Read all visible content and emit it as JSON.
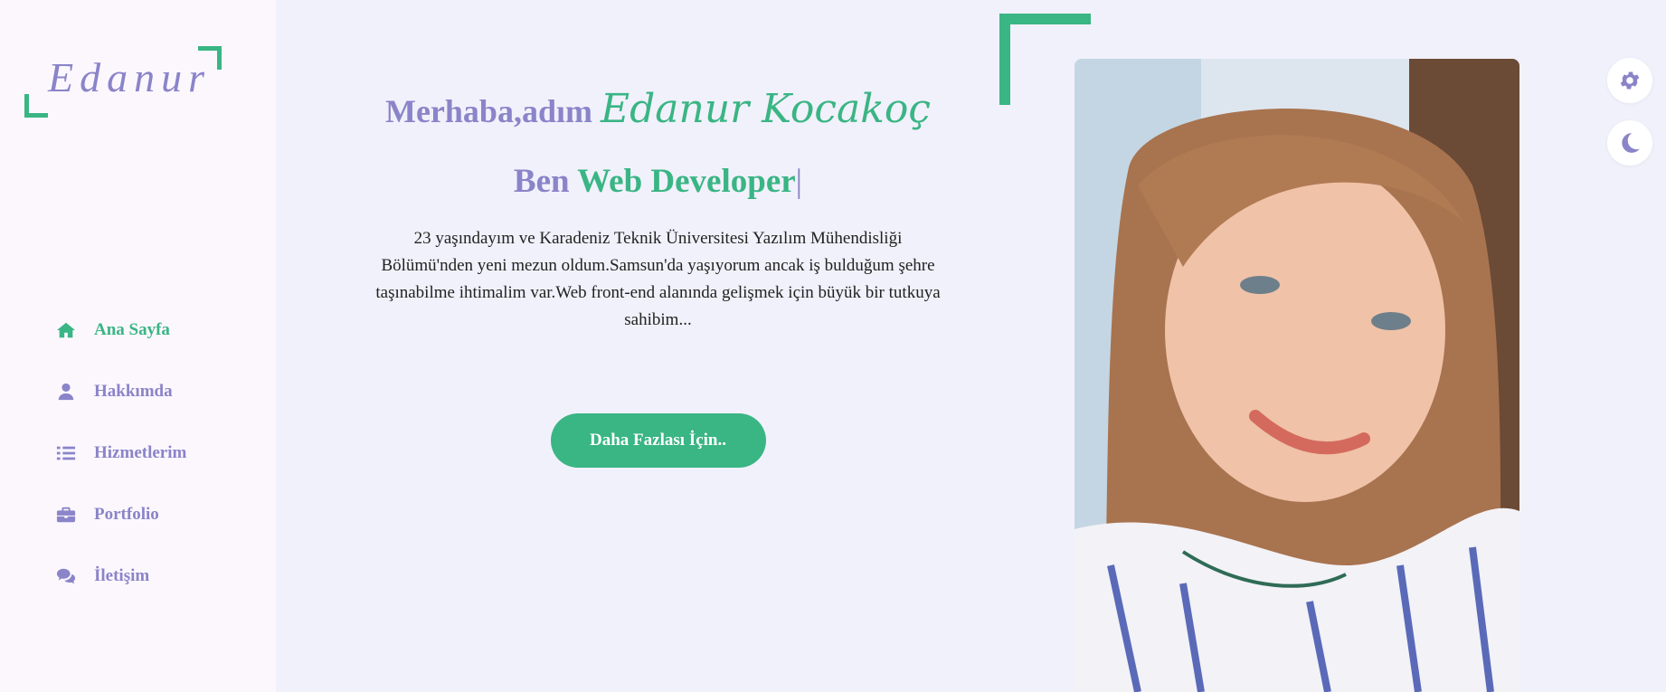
{
  "brand": {
    "logo_text": "Edanur"
  },
  "nav": {
    "items": [
      {
        "label": "Ana Sayfa",
        "icon": "home-icon",
        "active": true
      },
      {
        "label": "Hakkımda",
        "icon": "user-icon",
        "active": false
      },
      {
        "label": "Hizmetlerim",
        "icon": "list-icon",
        "active": false
      },
      {
        "label": "Portfolio",
        "icon": "briefcase-icon",
        "active": false
      },
      {
        "label": "İletişim",
        "icon": "comments-icon",
        "active": false
      }
    ]
  },
  "hero": {
    "greeting_prefix": "Merhaba,adım",
    "greeting_name": "Edanur Kocakoç",
    "role_prefix": "Ben",
    "role_word": "Web Developer",
    "role_cursor": "|",
    "bio": "23 yaşındayım ve Karadeniz Teknik Üniversitesi Yazılım Mühendisliği Bölümü'nden yeni mezun oldum.Samsun'da yaşıyorum ancak iş bulduğum şehre taşınabilme ihtimalim var.Web front-end alanında gelişmek için büyük bir tutkuya sahibim...",
    "cta_label": "Daha Fazlası İçin.."
  },
  "controls": {
    "settings_icon": "gear-icon",
    "theme_icon": "moon-icon"
  },
  "colors": {
    "accent_green": "#3ab584",
    "accent_purple": "#8a84c9",
    "sidebar_bg": "#fcf7fd",
    "page_bg": "#f1f1fb"
  }
}
